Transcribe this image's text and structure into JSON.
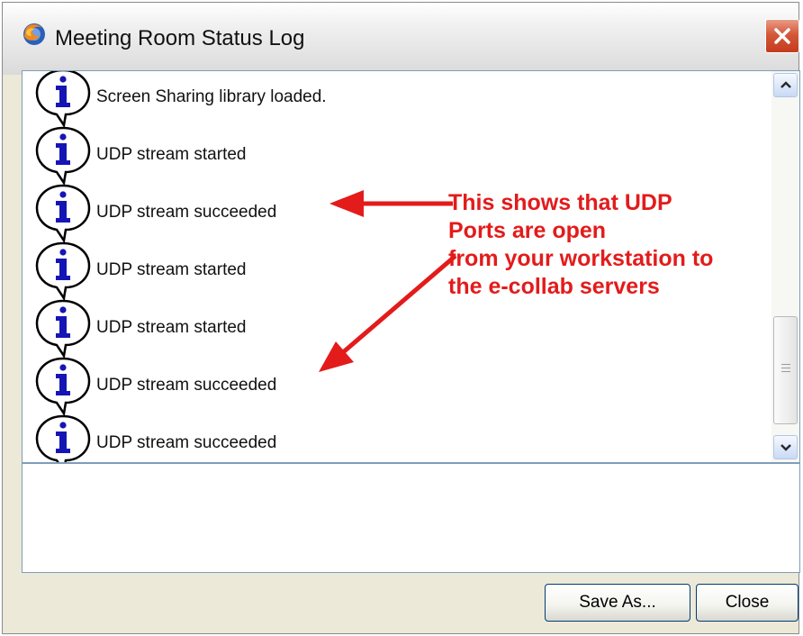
{
  "window": {
    "title": "Meeting Room Status Log",
    "title_icon": "firefox-icon",
    "close_icon": "close-icon"
  },
  "log": {
    "entries": [
      {
        "icon": "info-icon",
        "text": "Screen Sharing library loaded."
      },
      {
        "icon": "info-icon",
        "text": "UDP stream started"
      },
      {
        "icon": "info-icon",
        "text": "UDP stream succeeded"
      },
      {
        "icon": "info-icon",
        "text": "UDP stream started"
      },
      {
        "icon": "info-icon",
        "text": "UDP stream started"
      },
      {
        "icon": "info-icon",
        "text": "UDP stream succeeded"
      },
      {
        "icon": "info-icon",
        "text": "UDP stream succeeded"
      }
    ]
  },
  "annotation": {
    "lines": [
      "This shows that UDP",
      "Ports are open",
      "from your workstation to",
      "the e-collab servers"
    ],
    "color": "#e31b1b"
  },
  "buttons": {
    "save_as": "Save As...",
    "close": "Close"
  },
  "colors": {
    "panel_border": "#7f9db9",
    "window_bg": "#ece9d8",
    "close_button": "#d4583a",
    "info_icon": "#1515b5"
  }
}
